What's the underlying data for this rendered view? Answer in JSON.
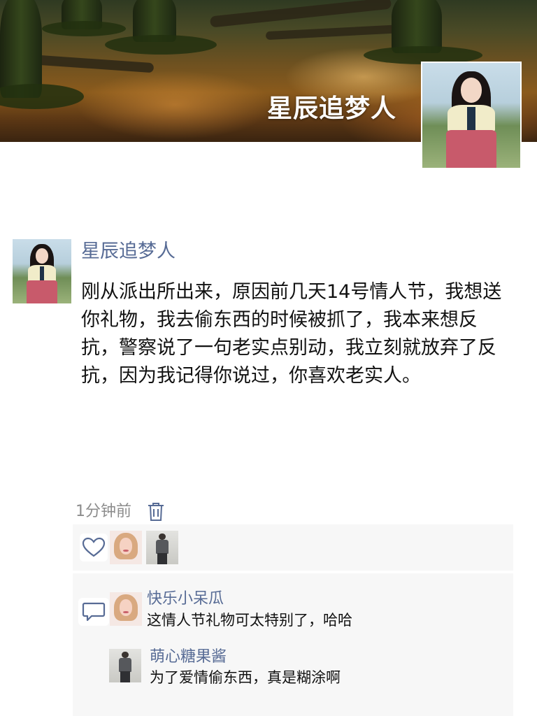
{
  "cover": {
    "nickname": "星辰追梦人"
  },
  "post": {
    "author": "星辰追梦人",
    "content": "刚从派出所出来，原因前几天14号情人节，我想送你礼物，我去偷东西的时候被抓了，我本来想反抗，警察说了一句老实点别动，我立刻就放弃了反抗，因为我记得你说过，你喜欢老实人。",
    "time": "1分钟前"
  },
  "icons": {
    "delete": "trash-icon",
    "like": "heart-icon",
    "comment": "comment-icon"
  },
  "comments": [
    {
      "author": "快乐小呆瓜",
      "text": "这情人节礼物可太特别了，哈哈"
    },
    {
      "author": "萌心糖果酱",
      "text": "为了爱情偷东西，真是糊涂啊"
    }
  ],
  "colors": {
    "link_blue": "#576b95",
    "panel_bg": "#f7f7f7",
    "time_gray": "#8c8c8c"
  }
}
